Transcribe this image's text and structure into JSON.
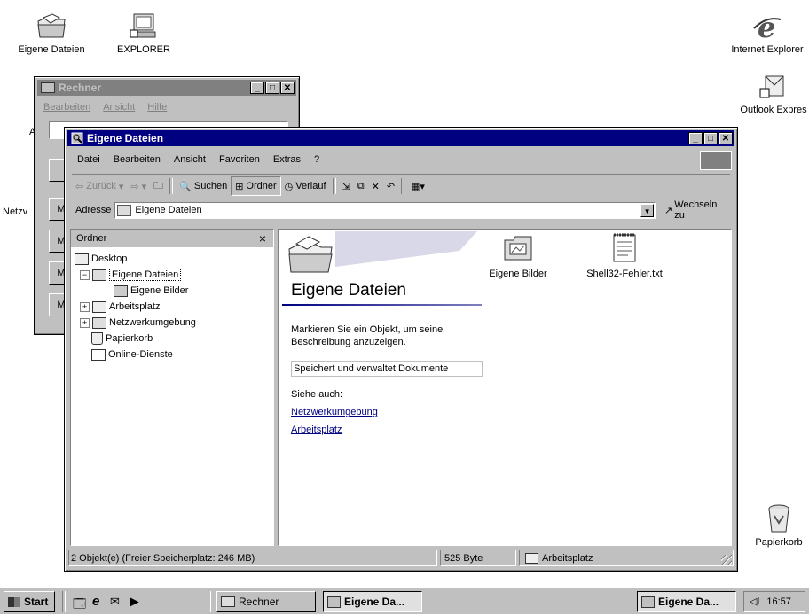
{
  "desktop": {
    "icons_left": [
      {
        "label": "Eigene Dateien",
        "icon": "folder-docs-icon"
      },
      {
        "label": "EXPLORER",
        "icon": "computer-icon"
      }
    ],
    "icons_right": [
      {
        "label": "Internet Explorer",
        "icon": "ie-icon"
      },
      {
        "label": "Outlook Expres",
        "icon": "outlook-icon"
      },
      {
        "label": "Papierkorb",
        "icon": "recycle-bin-icon"
      }
    ],
    "bg_label_netz": "Netzv"
  },
  "rechner": {
    "title": "Rechner",
    "menu": [
      "Bearbeiten",
      "Ansicht",
      "Hilfe"
    ],
    "side_letter": "A",
    "mem_buttons": [
      "M",
      "M",
      "M",
      "M",
      "M"
    ]
  },
  "explorer": {
    "title": "Eigene Dateien",
    "menu": [
      "Datei",
      "Bearbeiten",
      "Ansicht",
      "Favoriten",
      "Extras",
      "?"
    ],
    "toolbar": {
      "back": "Zurück",
      "search": "Suchen",
      "folders": "Ordner",
      "history": "Verlauf"
    },
    "address": {
      "label": "Adresse",
      "value": "Eigene Dateien",
      "go": "Wechseln zu"
    },
    "folder_pane": {
      "title": "Ordner",
      "close": "×",
      "items": [
        {
          "label": "Desktop",
          "level": 0,
          "icon": "desktop-icon",
          "expander": ""
        },
        {
          "label": "Eigene Dateien",
          "level": 1,
          "icon": "folder-docs-icon",
          "expander": "−",
          "selected": true
        },
        {
          "label": "Eigene Bilder",
          "level": 2,
          "icon": "pictures-folder-icon",
          "expander": ""
        },
        {
          "label": "Arbeitsplatz",
          "level": 1,
          "icon": "computer-icon",
          "expander": "+"
        },
        {
          "label": "Netzwerkumgebung",
          "level": 1,
          "icon": "network-icon",
          "expander": "+"
        },
        {
          "label": "Papierkorb",
          "level": 1,
          "icon": "recycle-bin-icon",
          "expander": ""
        },
        {
          "label": "Online-Dienste",
          "level": 1,
          "icon": "folder-icon",
          "expander": ""
        }
      ]
    },
    "content": {
      "heading": "Eigene Dateien",
      "hint": "Markieren Sie ein Objekt, um seine Beschreibung anzuzeigen.",
      "description": "Speichert und verwaltet Dokumente",
      "see_also": "Siehe auch:",
      "links": [
        "Netzwerkumgebung",
        "Arbeitsplatz"
      ],
      "files": [
        {
          "label": "Eigene Bilder",
          "icon": "pictures-folder-icon"
        },
        {
          "label": "Shell32-Fehler.txt",
          "icon": "text-file-icon"
        }
      ]
    },
    "status": {
      "objects": "2 Objekt(e) (Freier Speicherplatz: 246 MB)",
      "size": "525 Byte",
      "zone": "Arbeitsplatz"
    }
  },
  "taskbar": {
    "start": "Start",
    "buttons": [
      {
        "label": "Rechner",
        "pressed": false
      },
      {
        "label": "Eigene Da...",
        "pressed": true
      },
      {
        "label": "Eigene Da...",
        "pressed": true
      }
    ],
    "clock": "16:57"
  },
  "colors": {
    "title_active": "#000080",
    "title_inactive": "#808080",
    "face": "#c0c0c0"
  }
}
